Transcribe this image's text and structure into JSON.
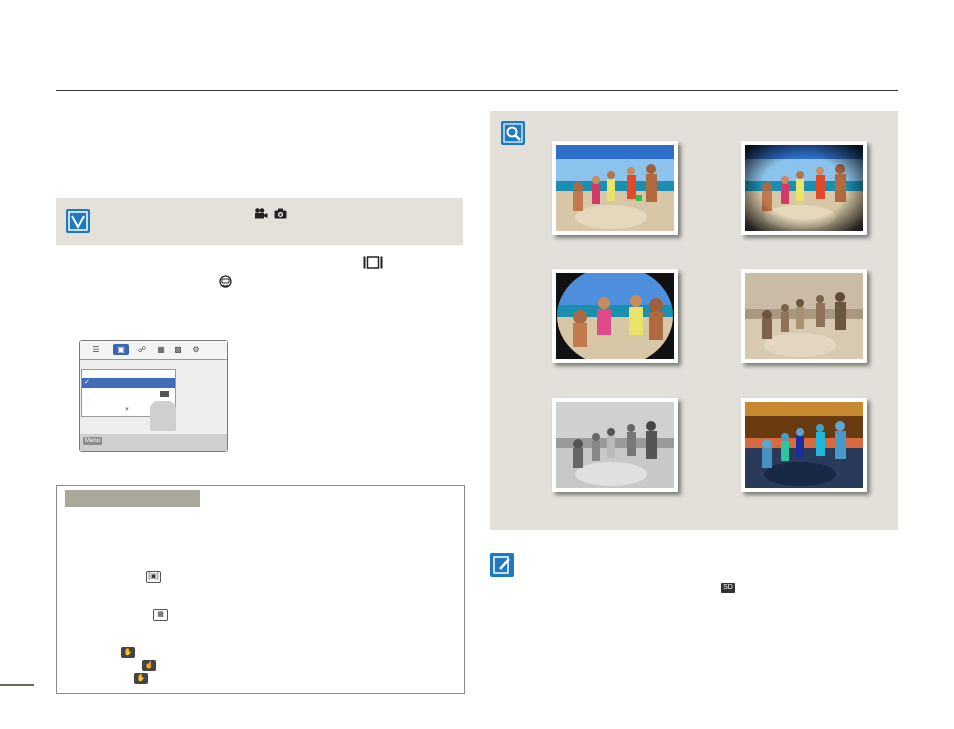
{
  "page": {
    "background": "#ffffff",
    "accent": "#1f79bf",
    "note_bar_color": "#e3e1da",
    "gallery_color": "#e2e0d9",
    "tip_label_color": "#aaa89a"
  },
  "icons": {
    "note_check": "check-icon",
    "video_mode": "video-camera-icon",
    "photo_mode": "camera-icon",
    "display_button": "display-frame-icon",
    "scene_mode": "diver-icon",
    "zoom": "magnifier-icon",
    "memo": "pencil-icon",
    "sd_card": "sd-card-icon"
  },
  "lcd": {
    "menu_label": "Menu"
  },
  "gallery": {
    "photos": [
      {
        "effect": "normal"
      },
      {
        "effect": "vignette"
      },
      {
        "effect": "fisheye"
      },
      {
        "effect": "sepia"
      },
      {
        "effect": "black-white"
      },
      {
        "effect": "negative"
      }
    ]
  },
  "sd_label": "SD"
}
